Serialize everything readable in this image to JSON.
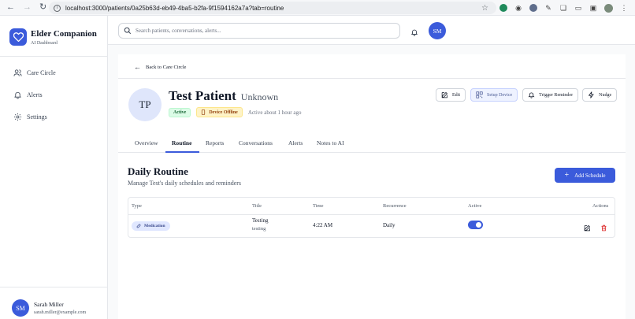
{
  "browser": {
    "url": "localhost:3000/patients/0a25b63d-eb49-4ba5-b2fa-9f1594162a7a?tab=routine"
  },
  "sidebar": {
    "brand_title": "Elder Companion",
    "brand_subtitle": "AI Dashboard",
    "items": [
      {
        "label": "Care Circle",
        "icon": "users-icon"
      },
      {
        "label": "Alerts",
        "icon": "bell-icon"
      },
      {
        "label": "Settings",
        "icon": "gear-icon"
      }
    ],
    "user": {
      "initials": "SM",
      "name": "Sarah Miller",
      "email": "sarah.miller@example.com"
    }
  },
  "header": {
    "search_placeholder": "Search patients, conversations, alerts...",
    "avatar_initials": "SM"
  },
  "patient": {
    "back_label": "Back to Care Circle",
    "initials": "TP",
    "name": "Test Patient",
    "subtitle": "Unknown",
    "status_badge": "Active",
    "device_badge": "Device Offline",
    "last_active": "Active about 1 hour ago",
    "actions": {
      "edit": "Edit",
      "setup": "Setup Device",
      "reminder": "Trigger Reminder",
      "nudge": "Nudge"
    }
  },
  "tabs": [
    "Overview",
    "Routine",
    "Reports",
    "Conversations",
    "Alerts",
    "Notes to AI"
  ],
  "active_tab": "Routine",
  "routine": {
    "title": "Daily Routine",
    "subtitle": "Manage Test's daily schedules and reminders",
    "add_label": "Add Schedule",
    "columns": [
      "Type",
      "Title",
      "Time",
      "Recurrence",
      "Active",
      "Actions"
    ],
    "rows": [
      {
        "type": "Medication",
        "title": "Testing",
        "description": "testing",
        "time": "4:22 AM",
        "recurrence": "Daily",
        "active": true
      }
    ]
  },
  "colors": {
    "accent": "#3b5bdb",
    "active_badge": "#dcfce7",
    "offline_badge": "#fef3c7",
    "delete": "#dc2626"
  }
}
